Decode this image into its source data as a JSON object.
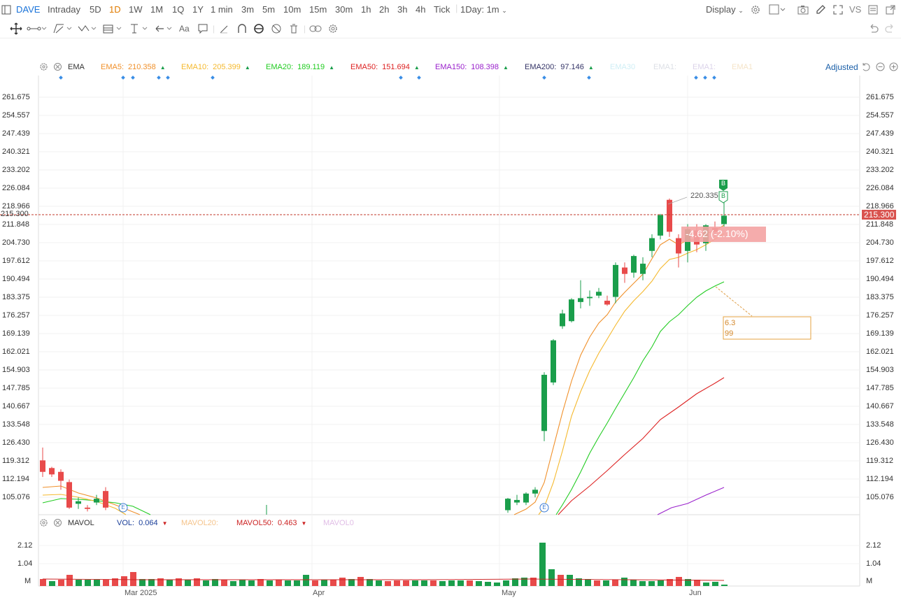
{
  "symbol": "DAVE",
  "periods": [
    "Intraday",
    "5D",
    "1D",
    "1W",
    "1M",
    "1Q",
    "1Y",
    "1 min",
    "3m",
    "5m",
    "10m",
    "15m",
    "30m",
    "1h",
    "2h",
    "3h",
    "4h",
    "Tick"
  ],
  "active_period": "1D",
  "interval_select": "1Day: 1m",
  "display_label": "Display",
  "vs_label": "VS",
  "text_tool": "Aa",
  "ema_legend": {
    "name": "EMA",
    "items": [
      {
        "label": "EMA5:",
        "value": "210.358",
        "color": "#f0902a"
      },
      {
        "label": "EMA10:",
        "value": "205.399",
        "color": "#f5b92e"
      },
      {
        "label": "EMA20:",
        "value": "189.119",
        "color": "#22cc22"
      },
      {
        "label": "EMA50:",
        "value": "151.694",
        "color": "#dd2222"
      },
      {
        "label": "EMA150:",
        "value": "108.398",
        "color": "#9a22cc"
      },
      {
        "label": "EMA200:",
        "value": "97.146",
        "color": "#333366"
      }
    ],
    "faded": [
      "EMA30",
      "EMA1:",
      "EMA1:",
      "EMA1"
    ]
  },
  "adjusted_label": "Adjusted",
  "price_axis": [
    "261.675",
    "254.557",
    "247.439",
    "240.321",
    "233.202",
    "226.084",
    "218.966",
    "211.848",
    "204.730",
    "197.612",
    "190.494",
    "183.375",
    "176.257",
    "169.139",
    "162.021",
    "154.903",
    "147.785",
    "140.667",
    "133.548",
    "126.430",
    "119.312",
    "112.194",
    "105.076"
  ],
  "current_price": "215.300",
  "high_marker": "220.335",
  "change_tag": {
    "value": "-4.62",
    "pct": "(-2.10%)"
  },
  "order_box": {
    "line1": "6.3",
    "line2": "99"
  },
  "markers": {
    "buy": "B",
    "earnings": "E"
  },
  "vol_legend": {
    "name": "MAVOL",
    "items": [
      {
        "label": "VOL:",
        "value": "0.064",
        "color": "#1a3e99"
      },
      {
        "label": "MAVOL20:",
        "value": "",
        "color": "#f5c38a"
      },
      {
        "label": "MAVOL50:",
        "value": "0.463",
        "color": "#cc2222"
      },
      {
        "label": "MAVOL0",
        "value": "",
        "color": "#e0bde6"
      }
    ]
  },
  "vol_axis": [
    "2.12",
    "1.04",
    "M"
  ],
  "x_labels": [
    "Mar 2025",
    "Apr",
    "May",
    "Jun"
  ],
  "colors": {
    "up": "#1a9e4b",
    "down": "#e84a4a",
    "accent": "#1a73d9",
    "active": "#e07b00"
  }
}
